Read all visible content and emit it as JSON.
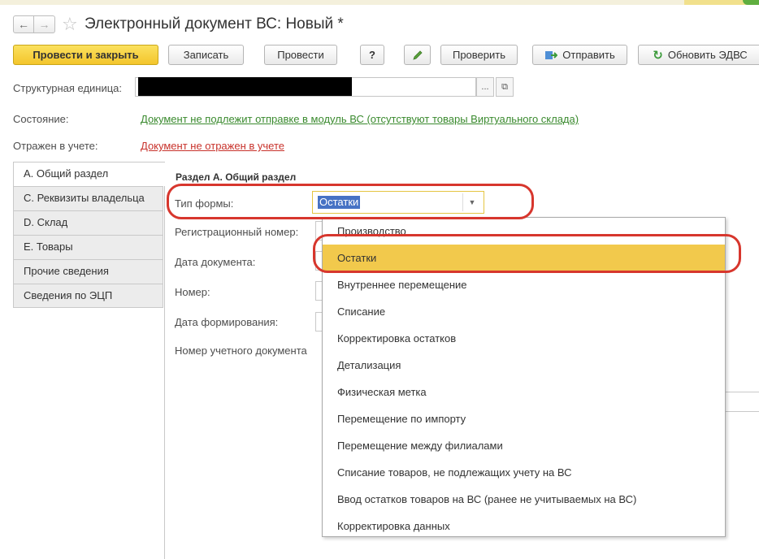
{
  "window": {
    "title": "Электронный документ ВС:  Новый *"
  },
  "toolbar": {
    "post_close": "Провести и закрыть",
    "save": "Записать",
    "post": "Провести",
    "help": "?",
    "check": "Проверить",
    "send": "Отправить",
    "refresh": "Обновить ЭДВС"
  },
  "header": {
    "struct_label": "Структурная единица:",
    "struct_dots": "...",
    "state_label": "Состояние:",
    "state_value": "Документ не подлежит отправке в модуль ВС (отсутствуют товары Виртуального склада)",
    "posted_label": "Отражен в учете:",
    "posted_value": "Документ не отражен в учете"
  },
  "tabs": [
    {
      "label": "A. Общий раздел",
      "active": true
    },
    {
      "label": "C. Реквизиты владельца",
      "active": false
    },
    {
      "label": "D. Склад",
      "active": false
    },
    {
      "label": "E. Товары",
      "active": false
    },
    {
      "label": "Прочие сведения",
      "active": false
    },
    {
      "label": "Сведения по ЭЦП",
      "active": false
    }
  ],
  "section": {
    "title": "Раздел А. Общий раздел",
    "form_type_label": "Тип формы:",
    "form_type_value": "Остатки",
    "reg_label": "Регистрационный номер:",
    "date_label": "Дата документа:",
    "num_label": "Номер:",
    "gen_label": "Дата формирования:",
    "acc_label": "Номер учетного документа"
  },
  "dropdown": {
    "selected_index": 1,
    "items": [
      "Производство",
      "Остатки",
      "Внутреннее перемещение",
      "Списание",
      "Корректировка остатков",
      "Детализация",
      "Физическая метка",
      "Перемещение по импорту",
      "Перемещение между филиалами",
      "Списание товаров, не подлежащих учету на ВС",
      "Ввод остатков товаров на ВС (ранее не учитываемых на ВС)",
      "Корректировка данных"
    ]
  },
  "colors": {
    "accent_yellow": "#f2c94c",
    "highlight_red": "#d7362d",
    "link_green": "#3a8a2e",
    "link_red": "#c8322b"
  }
}
